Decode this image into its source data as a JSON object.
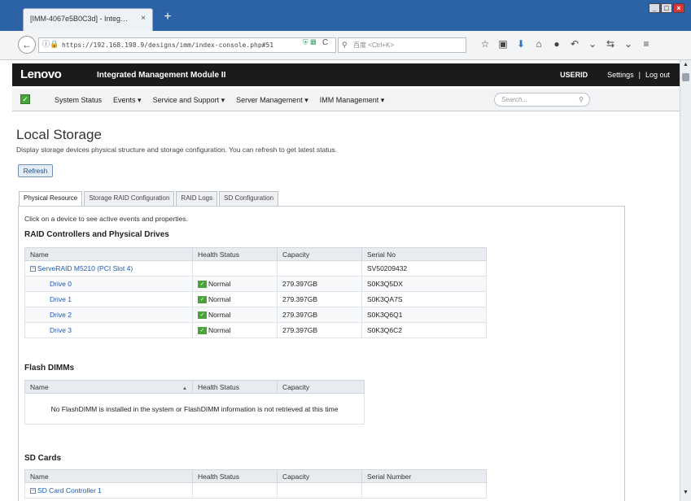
{
  "browser": {
    "tab_title": "[IMM-4067e5B0C3d] - Integ…",
    "tab_close": "×",
    "new_tab": "+",
    "win_min": "_",
    "win_max": "□",
    "win_close": "×",
    "back": "←",
    "url": "https://192.168.198.9/designs/imm/index-console.php#51",
    "search_placeholder": "百度 <Ctrl+K>",
    "reload": "C"
  },
  "imm": {
    "logo": "Lenovo",
    "product": "Integrated Management Module II",
    "user": "USERID",
    "settings": "Settings",
    "separator": "|",
    "logout": "Log out"
  },
  "menu": {
    "items": [
      "System Status",
      "Events ▾",
      "Service and Support ▾",
      "Server Management ▾",
      "IMM Management ▾"
    ],
    "search_placeholder": "Search..."
  },
  "page": {
    "title": "Local Storage",
    "description": "Display storage devices physical structure and storage configuration. You can refresh to get latest status.",
    "refresh": "Refresh",
    "tabs": [
      "Physical Resource",
      "Storage RAID Configuration",
      "RAID Logs",
      "SD Configuration"
    ],
    "hint": "Click on a device to see active events and properties."
  },
  "raid": {
    "title": "RAID Controllers and Physical Drives",
    "headers": [
      "Name",
      "Health Status",
      "Capacity",
      "Serial No"
    ],
    "controller": {
      "name": "ServeRAID M5210 (PCI Slot 4)",
      "serial": "SV50209432"
    },
    "drives": [
      {
        "name": "Drive 0",
        "status": "Normal",
        "capacity": "279.397GB",
        "serial": "S0K3Q5DX"
      },
      {
        "name": "Drive 1",
        "status": "Normal",
        "capacity": "279.397GB",
        "serial": "S0K3QA7S"
      },
      {
        "name": "Drive 2",
        "status": "Normal",
        "capacity": "279.397GB",
        "serial": "S0K3Q6Q1"
      },
      {
        "name": "Drive 3",
        "status": "Normal",
        "capacity": "279.397GB",
        "serial": "S0K3Q6C2"
      }
    ]
  },
  "flash": {
    "title": "Flash DIMMs",
    "headers": [
      "Name",
      "Health Status",
      "Capacity"
    ],
    "empty": "No FlashDIMM is installed in the system or FlashDIMM information is not retrieved at this time"
  },
  "sd": {
    "title": "SD Cards",
    "headers": [
      "Name",
      "Health Status",
      "Capacity",
      "Serial Number"
    ],
    "first_row": "SD Card Controller 1"
  },
  "colors": {
    "header_bg": "#1b1b1b",
    "browser_blue": "#2b63a6",
    "link": "#1a58b3",
    "ok_green": "#4aa23b"
  }
}
